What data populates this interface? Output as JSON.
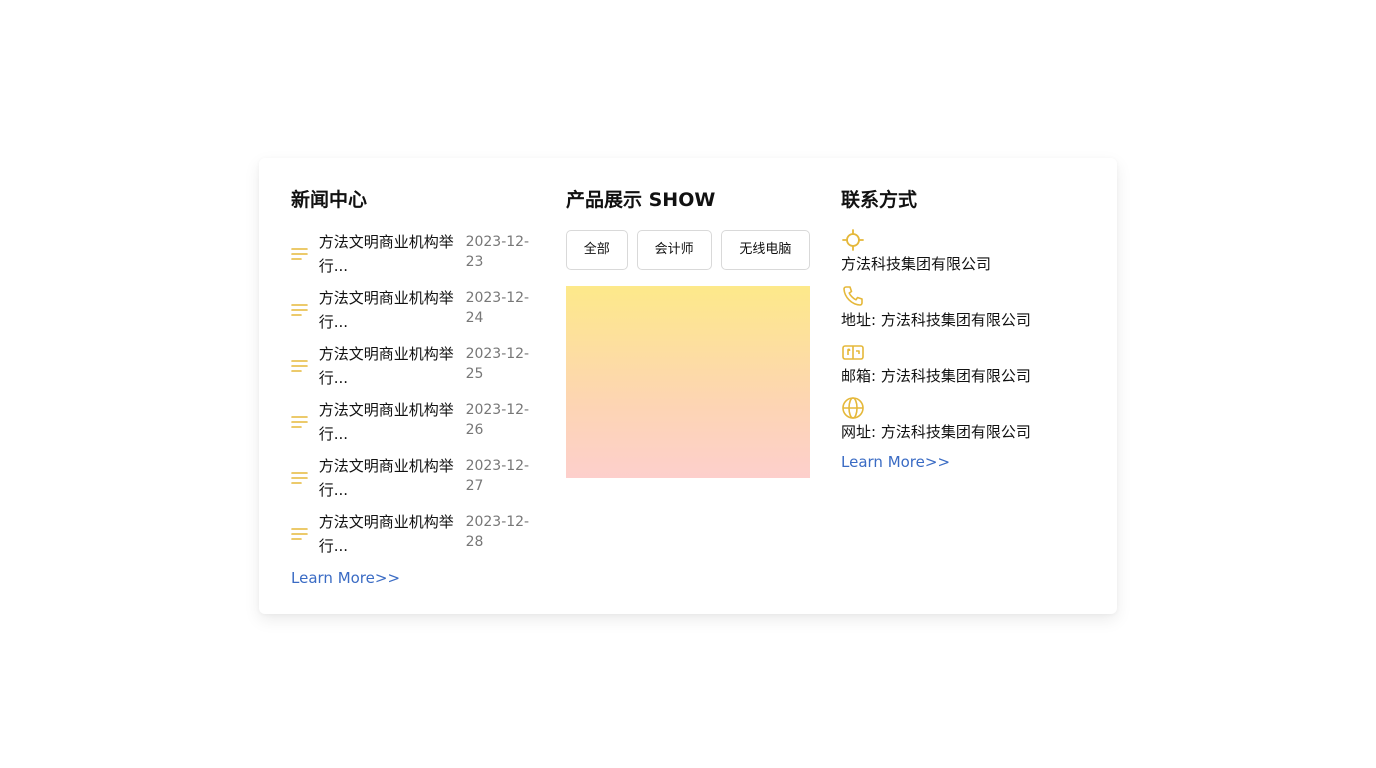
{
  "news": {
    "title": "新闻中心",
    "items": [
      {
        "title": "方法文明商业机构举行...",
        "date": "2023-12-23"
      },
      {
        "title": "方法文明商业机构举行...",
        "date": "2023-12-24"
      },
      {
        "title": "方法文明商业机构举行...",
        "date": "2023-12-25"
      },
      {
        "title": "方法文明商业机构举行...",
        "date": "2023-12-26"
      },
      {
        "title": "方法文明商业机构举行...",
        "date": "2023-12-27"
      },
      {
        "title": "方法文明商业机构举行...",
        "date": "2023-12-28"
      }
    ],
    "learn_more": "Learn More>>",
    "item_icon": "list-lines-icon"
  },
  "products": {
    "title": "产品展示 SHOW",
    "tabs": [
      "全部",
      "会计师",
      "无线电脑"
    ]
  },
  "contact": {
    "title": "联系方式",
    "items": [
      {
        "icon": "location-crosshair-icon",
        "text": "方法科技集团有限公司"
      },
      {
        "icon": "phone-icon",
        "text": "地址: 方法科技集团有限公司"
      },
      {
        "icon": "mail-box-icon",
        "text": "邮箱: 方法科技集团有限公司"
      },
      {
        "icon": "globe-icon",
        "text": "网址: 方法科技集团有限公司"
      }
    ],
    "learn_more": "Learn More>>"
  },
  "colors": {
    "accent_icon": "#e5b83a",
    "link": "#3a6bc4",
    "date_text": "#777777",
    "gradient_top": "#fde98a",
    "gradient_bottom": "#fdcfcc"
  }
}
